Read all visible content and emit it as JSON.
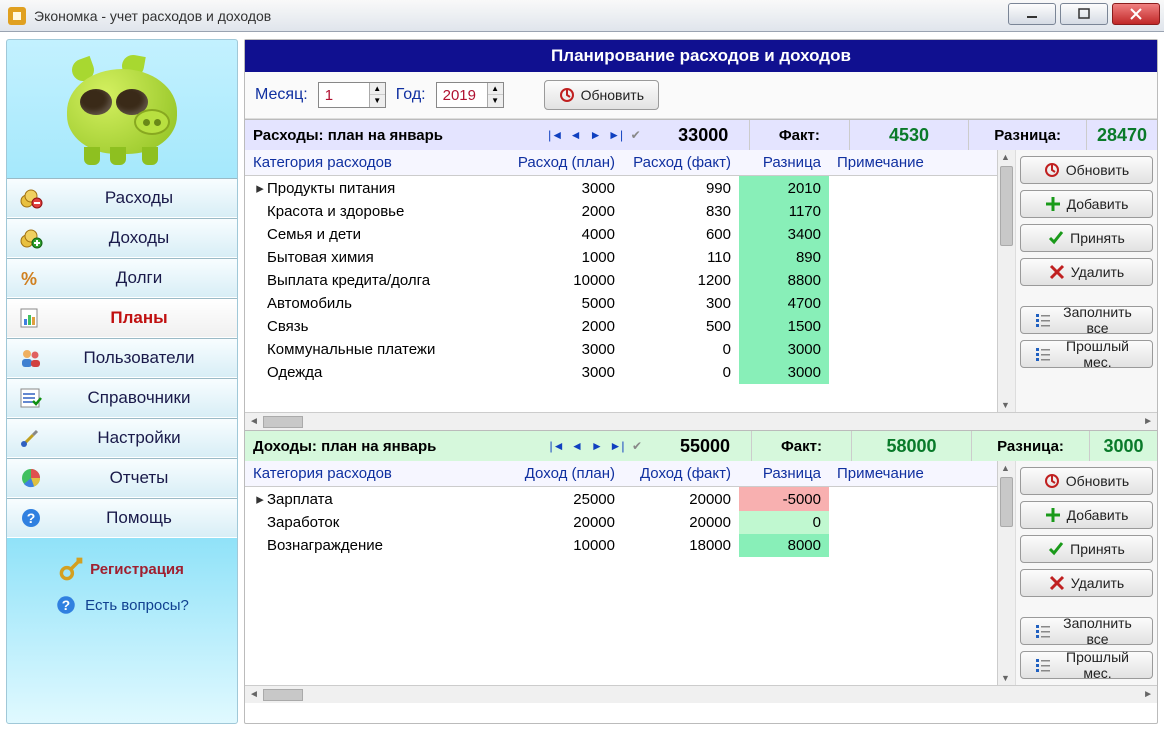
{
  "window": {
    "title": "Экономка - учет расходов и доходов"
  },
  "sidebar": {
    "items": [
      {
        "label": "Расходы",
        "icon": "coins-minus"
      },
      {
        "label": "Доходы",
        "icon": "coins-plus"
      },
      {
        "label": "Долги",
        "icon": "percent"
      },
      {
        "label": "Планы",
        "icon": "sheet-chart",
        "active": true
      },
      {
        "label": "Пользователи",
        "icon": "people"
      },
      {
        "label": "Справочники",
        "icon": "list-check"
      },
      {
        "label": "Настройки",
        "icon": "tools"
      },
      {
        "label": "Отчеты",
        "icon": "pie"
      },
      {
        "label": "Помощь",
        "icon": "help"
      }
    ],
    "register": "Регистрация",
    "questions": "Есть вопросы?"
  },
  "banner": "Планирование расходов и доходов",
  "controls": {
    "month_label": "Месяц:",
    "month_value": "1",
    "year_label": "Год:",
    "year_value": "2019",
    "refresh": "Обновить"
  },
  "expenses": {
    "title": "Расходы: план на январь",
    "plan_total": "33000",
    "fact_label": "Факт:",
    "fact_total": "4530",
    "diff_label": "Разница:",
    "diff_total": "28470",
    "columns": {
      "cat": "Категория расходов",
      "plan": "Расход (план)",
      "fact": "Расход (факт)",
      "diff": "Разница",
      "note": "Примечание"
    },
    "rows": [
      {
        "cat": "Продукты питания",
        "plan": "3000",
        "fact": "990",
        "diff": "2010",
        "marker": true
      },
      {
        "cat": "Красота и здоровье",
        "plan": "2000",
        "fact": "830",
        "diff": "1170"
      },
      {
        "cat": "Семья и дети",
        "plan": "4000",
        "fact": "600",
        "diff": "3400"
      },
      {
        "cat": "Бытовая химия",
        "plan": "1000",
        "fact": "110",
        "diff": "890"
      },
      {
        "cat": "Выплата кредита/долга",
        "plan": "10000",
        "fact": "1200",
        "diff": "8800"
      },
      {
        "cat": "Автомобиль",
        "plan": "5000",
        "fact": "300",
        "diff": "4700"
      },
      {
        "cat": "Связь",
        "plan": "2000",
        "fact": "500",
        "diff": "1500"
      },
      {
        "cat": "Коммунальные платежи",
        "plan": "3000",
        "fact": "0",
        "diff": "3000"
      },
      {
        "cat": "Одежда",
        "plan": "3000",
        "fact": "0",
        "diff": "3000"
      }
    ]
  },
  "incomes": {
    "title": "Доходы: план на январь",
    "plan_total": "55000",
    "fact_label": "Факт:",
    "fact_total": "58000",
    "diff_label": "Разница:",
    "diff_total": "3000",
    "columns": {
      "cat": "Категория расходов",
      "plan": "Доход (план)",
      "fact": "Доход (факт)",
      "diff": "Разница",
      "note": "Примечание"
    },
    "rows": [
      {
        "cat": "Зарплата",
        "plan": "25000",
        "fact": "20000",
        "diff": "-5000",
        "marker": true,
        "neg": true
      },
      {
        "cat": "Заработок",
        "plan": "20000",
        "fact": "20000",
        "diff": "0",
        "zero": true
      },
      {
        "cat": "Вознаграждение",
        "plan": "10000",
        "fact": "18000",
        "diff": "8000"
      }
    ]
  },
  "buttons": {
    "refresh": "Обновить",
    "add": "Добавить",
    "accept": "Принять",
    "delete": "Удалить",
    "fill_all": "Заполнить все",
    "prev_month": "Прошлый мес."
  }
}
